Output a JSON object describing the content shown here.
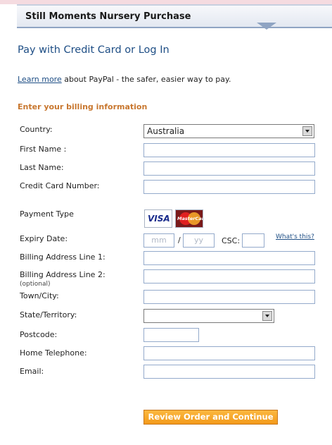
{
  "header": {
    "title": "Still Moments Nursery Purchase"
  },
  "page_title": "Pay with Credit Card or Log In",
  "learn": {
    "link": "Learn more",
    "text": " about PayPal - the safer, easier way to pay."
  },
  "section_heading": "Enter your billing information",
  "form": {
    "country_label": "Country:",
    "country_value": "Australia",
    "first_name_label": "First Name :",
    "last_name_label": "Last Name:",
    "card_number_label": "Credit Card Number:",
    "payment_type_label": "Payment Type",
    "visa_text": "VISA",
    "mastercard_text": "MasterCard",
    "expiry_label": "Expiry Date:",
    "month_placeholder": "mm",
    "slash": "/",
    "year_placeholder": "yy",
    "csc_label": "CSC:",
    "whats_this": "What's this?",
    "address1_label": "Billing Address Line 1:",
    "address2_label": "Billing Address Line 2:",
    "address2_note": "(optional)",
    "town_label": "Town/City:",
    "state_label": "State/Territory:",
    "state_value": "",
    "postcode_label": "Postcode:",
    "phone_label": "Home Telephone:",
    "email_label": "Email:"
  },
  "submit_label": "Review Order and Continue",
  "colors": {
    "accent": "#1e4e85",
    "heading": "#c8772f",
    "button": "#f5a623"
  }
}
